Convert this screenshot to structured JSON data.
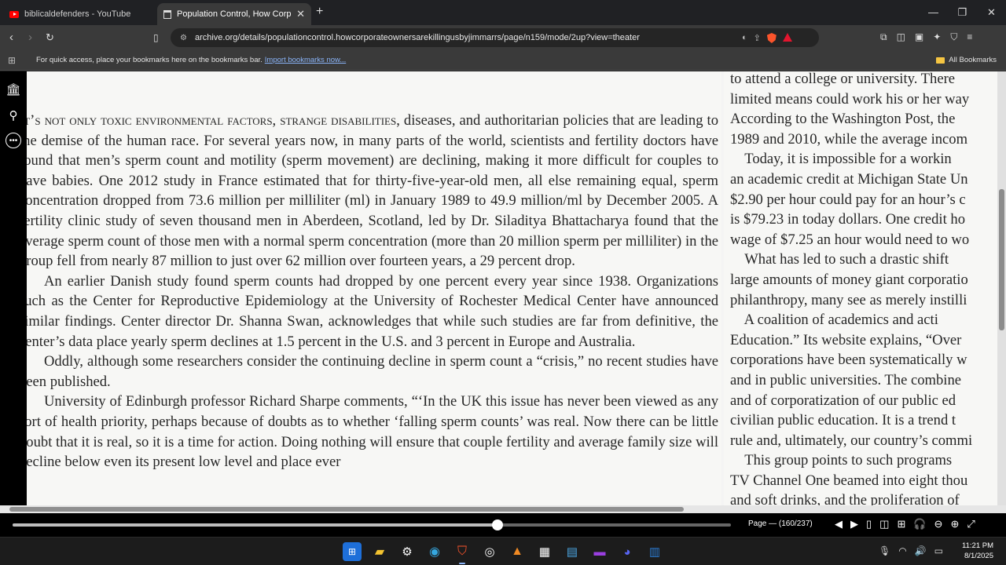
{
  "tabs": [
    {
      "title": "biblicaldefenders - YouTube",
      "icon": "youtube-icon"
    },
    {
      "title": "Population Control, How Corpor",
      "icon": "archive-page-icon"
    }
  ],
  "url": "archive.org/details/populationcontrol.howcorporateownersarekillingusbyjimmarrs/page/n159/mode/2up?view=theater",
  "bookmarks_bar": {
    "message": "For quick access, place your bookmarks here on the bookmarks bar.",
    "import_link": "Import bookmarks now...",
    "all_bookmarks": "All Bookmarks"
  },
  "left_page": {
    "p1_smallcaps": "t’s not only toxic environmental factors, strange disabilities",
    "p1_dropcap": "I",
    "p1_rest": ", diseases, and authoritarian policies that are leading to the demise of the human race. For several years now, in many parts of the world, scientists and fertility doctors have found that men’s sperm count and motility (sperm movement) are declining, making it more difficult for couples to have babies. One 2012 study in France estimated that for thirty-five-year-old men, all else remaining equal, sperm concentration dropped from 73.6 million per milliliter (ml) in January 1989 to 49.9 million/ml by December 2005. A fertility clinic study of seven thousand men in Aberdeen, Scotland, led by Dr. Siladitya Bhattacharya found that the average sperm count of those men with a normal sperm concentration (more than 20 million sperm per milliliter) in the group fell from nearly 87 million to just over 62 million over fourteen years, a 29 percent drop.",
    "p2": "An earlier Danish study found sperm counts had dropped by one percent every year since 1938. Organizations such as the Center for Reproductive Epidemiology at the University of Rochester Medical Center have announced similar findings. Center director Dr. Shanna Swan, acknowledges that while such studies are far from definitive, the center’s data place yearly sperm declines at 1.5 percent in the U.S. and 3 percent in Europe and Australia.",
    "p3": "Oddly, although some researchers consider the continuing decline in sperm count a “crisis,” no recent studies have been published.",
    "p4": "University of Edinburgh professor Richard Sharpe comments, “‘In the UK this issue has never been viewed as any sort of health priority, perhaps because of doubts as to whether ‘falling sperm counts’ was real. Now there can be little doubt that it is real, so it is a time for action. Doing nothing will ensure that couple fertility and average family size will decline below even its present low level and place ever"
  },
  "right_page": {
    "lines": [
      "to attend a college or university. There",
      "limited means could work his or her way",
      "According to the Washington Post, the",
      "1989 and 2010, while the average incom",
      "    Today, it is impossible for a workin",
      "an academic credit at Michigan State Un",
      "$2.90 per hour could pay for an hour’s c",
      "is $79.23 in today dollars. One credit ho",
      "wage of $7.25 an hour would need to wo",
      "    What has led to such a drastic shift",
      "large amounts of money giant corporatio",
      "philanthropy, many see as merely instilli",
      "    A coalition of academics and acti",
      "Education.” Its website explains, “Over",
      "corporations have been systematically w",
      "and in public universities. The combine",
      "and of corporatization of our public ed",
      "civilian public education. It is a trend t",
      "rule and, ultimately, our country’s commi",
      "    This group points to such programs",
      "TV Channel One beamed into eight thou",
      "and soft drinks, and the proliferation of"
    ]
  },
  "viewer": {
    "page_label": "Page — (160/237)",
    "progress": 0.675
  },
  "clock": {
    "time": "11:21 PM",
    "date": "8/1/2025"
  }
}
